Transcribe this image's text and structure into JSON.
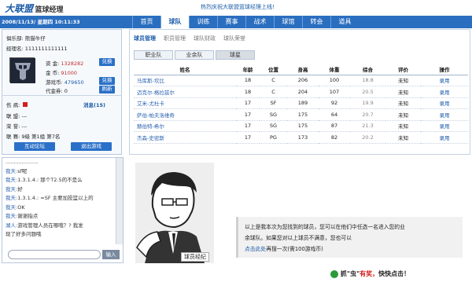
{
  "header": {
    "logo_main": "大联盟",
    "logo_sub": "篮球经理",
    "announcement": "热烈庆祝大联盟篮球经理上线!"
  },
  "topbar": {
    "datetime": "2008/11/13/ 星期四 10:11:33",
    "tabs": [
      "首页",
      "球队",
      "训练",
      "赛事",
      "战术",
      "球馆",
      "转会",
      "道具"
    ],
    "active_tab": 1
  },
  "profile": {
    "club_label": "俱乐部:",
    "club_value": "熊猫牛仔",
    "manager_label": "经理名:",
    "manager_value": "1111111111111",
    "funds_label": "资 金:",
    "funds_value": "1328282",
    "gold_label": "金 币:",
    "gold_value": "91000",
    "gamecoin_label": "游戏币:",
    "gamecoin_value": "479650",
    "voucher_label": "代金券:",
    "voucher_value": "0",
    "btn_exchange1": "兑换",
    "btn_exchange2": "兑换",
    "btn_refresh": "刷新",
    "injury_label": "伤 病:",
    "message_link": "消息(15)",
    "league_label": "联 盟:",
    "league_value": "---",
    "honor_label": "荣 誉:",
    "honor_value": "---",
    "match_label": "联 赛:",
    "match_value": "9级 第1组 第7名",
    "btn_forum": "互动论坛",
    "btn_exit": "退出游戏"
  },
  "chat": {
    "messages": [
      {
        "who": "",
        "text": "...................."
      },
      {
        "who": "我天:",
        "text": "sf呢"
      },
      {
        "who": "我天:",
        "text": "1.3.1.4.: 那个T2.5的不是么"
      },
      {
        "who": "我天:",
        "text": "好"
      },
      {
        "who": "我天:",
        "text": "1.3.1.4.: =SF 主要加投篮以上的"
      },
      {
        "who": "我天:",
        "text": "OK"
      },
      {
        "who": "我天:",
        "text": "谢谢指点"
      },
      {
        "who": "湖人:",
        "text": "游戏管理人员在哪哦？? 我发"
      },
      {
        "who": "",
        "text": "现了好多问题哦"
      }
    ],
    "send_label": "输入"
  },
  "main": {
    "subtabs": [
      "球员管理",
      "职员管理",
      "球队财政",
      "球队荣誉"
    ],
    "active_subtab": 0,
    "team_tabs": [
      "职业队",
      "业余队",
      "球星"
    ],
    "active_team_tab": 2,
    "columns": [
      "姓名",
      "年龄",
      "位置",
      "身高",
      "体重",
      "综合",
      "评价",
      "操作"
    ],
    "rows": [
      [
        "马库斯-坎比",
        "18",
        "C",
        "206",
        "100",
        "18.8",
        "未知",
        "录用"
      ],
      [
        "迈克尔-格拉兹尔",
        "18",
        "C",
        "204",
        "107",
        "20.5",
        "未知",
        "录用"
      ],
      [
        "艾米-尤杜卡",
        "17",
        "SF",
        "189",
        "92",
        "19.9",
        "未知",
        "录用"
      ],
      [
        "萨伯-帕夫洛维奇",
        "17",
        "SG",
        "175",
        "64",
        "20.7",
        "未知",
        "录用"
      ],
      [
        "赫伯特-希尔",
        "17",
        "SG",
        "175",
        "87",
        "21.3",
        "未知",
        "录用"
      ],
      [
        "杰森-史密斯",
        "17",
        "PG",
        "173",
        "82",
        "20.2",
        "未知",
        "录用"
      ]
    ]
  },
  "illustration": {
    "caption": "球员经纪"
  },
  "info": {
    "line1": "以上是我本次为您找到的球员，您可以在他们中任选一名进入您的业",
    "line2": "余球队。如果您对以上球员不满意，您也可以",
    "link_text": "点击此处",
    "line3_rest": "再搜一次(需100游戏币)"
  },
  "footer": {
    "text_a": "抓",
    "text_b": "\"虫\"",
    "text_c": "有奖，",
    "text_d": "快快点击！"
  }
}
